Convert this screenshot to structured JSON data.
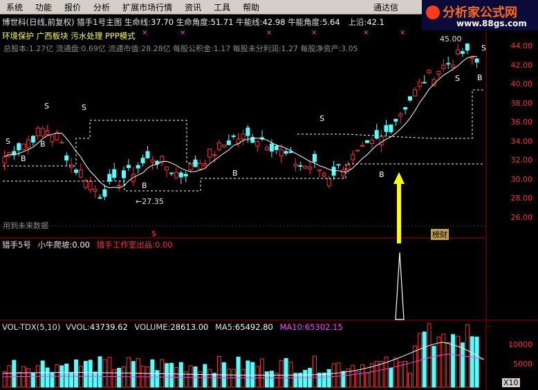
{
  "menu": [
    "系统",
    "功能",
    "报价",
    "分析",
    "扩展市场行情",
    "资讯",
    "工具",
    "帮助"
  ],
  "menu_right": "通达信",
  "brand": {
    "title": "分析家公式网",
    "url": "www.88gs.com"
  },
  "header": {
    "stock": "博世科(日线,前复权)",
    "indicator": "猎手1号主图",
    "life_line": {
      "label": "生命线:",
      "value": "37.70"
    },
    "life_angle": {
      "label": "生命角度:",
      "value": "51.71"
    },
    "bull_line": {
      "label": "牛能线:",
      "value": "42.98"
    },
    "bull_angle": {
      "label": "牛能角度:",
      "value": "5.64"
    },
    "upper": {
      "label": "上沿:",
      "value": "42.1"
    }
  },
  "concepts": "环境保护 广西板块 污水处理 PPP模式",
  "fundamentals": "总股本:1.27亿 流通盘:0.69亿 流通市值:28.28亿 每股公积金:1.17 每股未分利润:1.27 每股净资产:3.05",
  "annotations": {
    "low_price": "←27.35",
    "high_price": "45.00",
    "future_data": "用到未来数据",
    "badge": "榜财",
    "dollar": "$"
  },
  "price_axis": [
    "44.00",
    "42.00",
    "40.00",
    "38.00",
    "36.00",
    "34.00",
    "32.00",
    "30.00",
    "28.00",
    "26.00"
  ],
  "indicator_panel": {
    "name": "猎手5号",
    "calf": {
      "label": "小牛爬坡:",
      "value": "0.00"
    },
    "studio": {
      "label": "猎手工作室出品:",
      "value": "0.00"
    }
  },
  "volume_panel": {
    "name": "VOL-TDX(5,10)",
    "vvol": {
      "label": "VVOL:",
      "value": "43739.62"
    },
    "volume": {
      "label": "VOLUME:",
      "value": "28613.00"
    },
    "ma5": {
      "label": "MA5:",
      "value": "65492.80"
    },
    "ma10": {
      "label": "MA10:",
      "value": "65302.15"
    },
    "axis": [
      "10000",
      "5000"
    ],
    "unit": "X10"
  },
  "colors": {
    "up": "#ff3030",
    "down": "#54ffff",
    "ma10": "#ff40ff",
    "arrow": "#ffff00"
  }
}
